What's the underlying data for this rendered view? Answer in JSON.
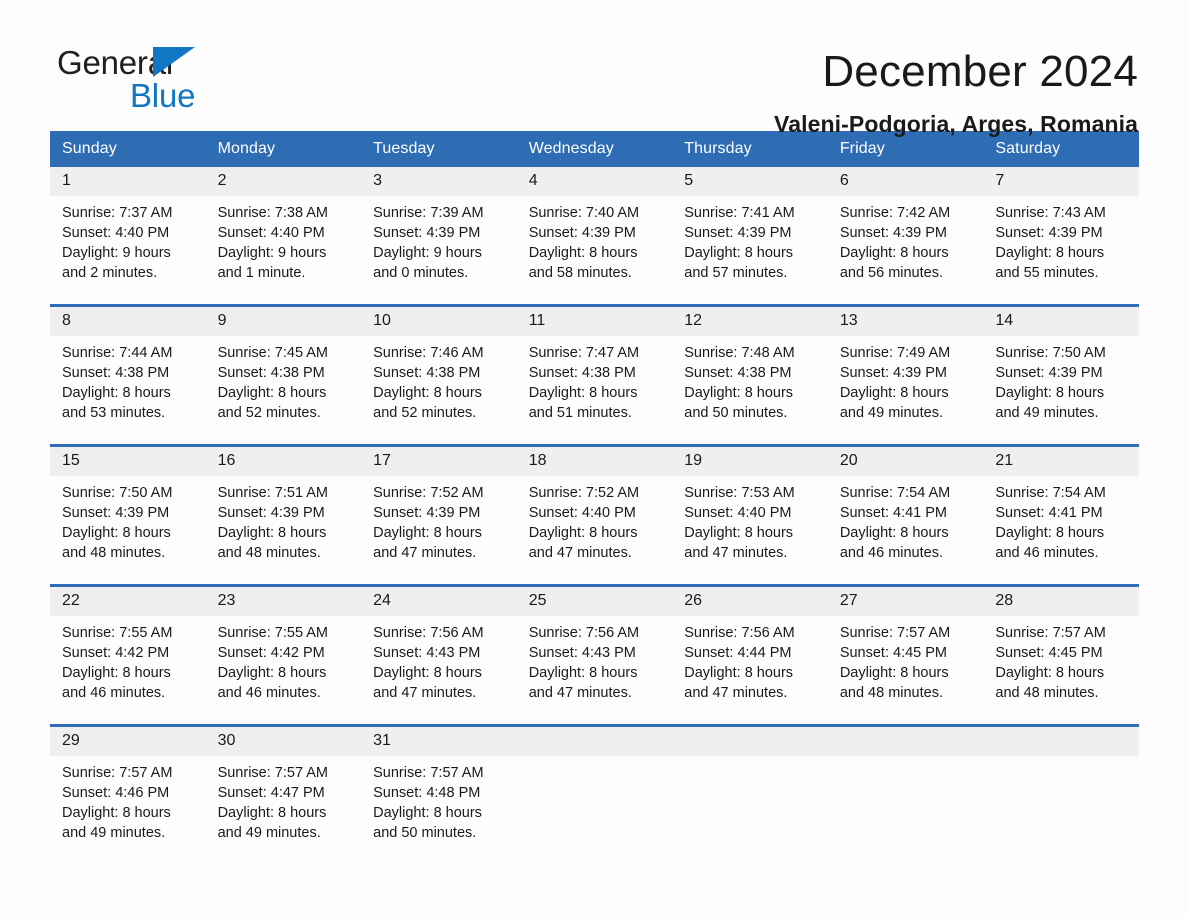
{
  "brand": {
    "name_part1": "General",
    "name_part2": "Blue",
    "triangle_color": "#1176c4",
    "icon": "triangle-logo"
  },
  "header": {
    "title": "December 2024",
    "subtitle": "Valeni-Podgoria, Arges, Romania"
  },
  "theme": {
    "header_blue": "#2e6db4",
    "daynum_gray": "#efefef",
    "text": "#1a1a1a",
    "page_bg": "#fdfdfd"
  },
  "weekdays": [
    "Sunday",
    "Monday",
    "Tuesday",
    "Wednesday",
    "Thursday",
    "Friday",
    "Saturday"
  ],
  "weeks": [
    [
      {
        "day": "1",
        "sunrise": "Sunrise: 7:37 AM",
        "sunset": "Sunset: 4:40 PM",
        "daylight1": "Daylight: 9 hours",
        "daylight2": "and 2 minutes."
      },
      {
        "day": "2",
        "sunrise": "Sunrise: 7:38 AM",
        "sunset": "Sunset: 4:40 PM",
        "daylight1": "Daylight: 9 hours",
        "daylight2": "and 1 minute."
      },
      {
        "day": "3",
        "sunrise": "Sunrise: 7:39 AM",
        "sunset": "Sunset: 4:39 PM",
        "daylight1": "Daylight: 9 hours",
        "daylight2": "and 0 minutes."
      },
      {
        "day": "4",
        "sunrise": "Sunrise: 7:40 AM",
        "sunset": "Sunset: 4:39 PM",
        "daylight1": "Daylight: 8 hours",
        "daylight2": "and 58 minutes."
      },
      {
        "day": "5",
        "sunrise": "Sunrise: 7:41 AM",
        "sunset": "Sunset: 4:39 PM",
        "daylight1": "Daylight: 8 hours",
        "daylight2": "and 57 minutes."
      },
      {
        "day": "6",
        "sunrise": "Sunrise: 7:42 AM",
        "sunset": "Sunset: 4:39 PM",
        "daylight1": "Daylight: 8 hours",
        "daylight2": "and 56 minutes."
      },
      {
        "day": "7",
        "sunrise": "Sunrise: 7:43 AM",
        "sunset": "Sunset: 4:39 PM",
        "daylight1": "Daylight: 8 hours",
        "daylight2": "and 55 minutes."
      }
    ],
    [
      {
        "day": "8",
        "sunrise": "Sunrise: 7:44 AM",
        "sunset": "Sunset: 4:38 PM",
        "daylight1": "Daylight: 8 hours",
        "daylight2": "and 53 minutes."
      },
      {
        "day": "9",
        "sunrise": "Sunrise: 7:45 AM",
        "sunset": "Sunset: 4:38 PM",
        "daylight1": "Daylight: 8 hours",
        "daylight2": "and 52 minutes."
      },
      {
        "day": "10",
        "sunrise": "Sunrise: 7:46 AM",
        "sunset": "Sunset: 4:38 PM",
        "daylight1": "Daylight: 8 hours",
        "daylight2": "and 52 minutes."
      },
      {
        "day": "11",
        "sunrise": "Sunrise: 7:47 AM",
        "sunset": "Sunset: 4:38 PM",
        "daylight1": "Daylight: 8 hours",
        "daylight2": "and 51 minutes."
      },
      {
        "day": "12",
        "sunrise": "Sunrise: 7:48 AM",
        "sunset": "Sunset: 4:38 PM",
        "daylight1": "Daylight: 8 hours",
        "daylight2": "and 50 minutes."
      },
      {
        "day": "13",
        "sunrise": "Sunrise: 7:49 AM",
        "sunset": "Sunset: 4:39 PM",
        "daylight1": "Daylight: 8 hours",
        "daylight2": "and 49 minutes."
      },
      {
        "day": "14",
        "sunrise": "Sunrise: 7:50 AM",
        "sunset": "Sunset: 4:39 PM",
        "daylight1": "Daylight: 8 hours",
        "daylight2": "and 49 minutes."
      }
    ],
    [
      {
        "day": "15",
        "sunrise": "Sunrise: 7:50 AM",
        "sunset": "Sunset: 4:39 PM",
        "daylight1": "Daylight: 8 hours",
        "daylight2": "and 48 minutes."
      },
      {
        "day": "16",
        "sunrise": "Sunrise: 7:51 AM",
        "sunset": "Sunset: 4:39 PM",
        "daylight1": "Daylight: 8 hours",
        "daylight2": "and 48 minutes."
      },
      {
        "day": "17",
        "sunrise": "Sunrise: 7:52 AM",
        "sunset": "Sunset: 4:39 PM",
        "daylight1": "Daylight: 8 hours",
        "daylight2": "and 47 minutes."
      },
      {
        "day": "18",
        "sunrise": "Sunrise: 7:52 AM",
        "sunset": "Sunset: 4:40 PM",
        "daylight1": "Daylight: 8 hours",
        "daylight2": "and 47 minutes."
      },
      {
        "day": "19",
        "sunrise": "Sunrise: 7:53 AM",
        "sunset": "Sunset: 4:40 PM",
        "daylight1": "Daylight: 8 hours",
        "daylight2": "and 47 minutes."
      },
      {
        "day": "20",
        "sunrise": "Sunrise: 7:54 AM",
        "sunset": "Sunset: 4:41 PM",
        "daylight1": "Daylight: 8 hours",
        "daylight2": "and 46 minutes."
      },
      {
        "day": "21",
        "sunrise": "Sunrise: 7:54 AM",
        "sunset": "Sunset: 4:41 PM",
        "daylight1": "Daylight: 8 hours",
        "daylight2": "and 46 minutes."
      }
    ],
    [
      {
        "day": "22",
        "sunrise": "Sunrise: 7:55 AM",
        "sunset": "Sunset: 4:42 PM",
        "daylight1": "Daylight: 8 hours",
        "daylight2": "and 46 minutes."
      },
      {
        "day": "23",
        "sunrise": "Sunrise: 7:55 AM",
        "sunset": "Sunset: 4:42 PM",
        "daylight1": "Daylight: 8 hours",
        "daylight2": "and 46 minutes."
      },
      {
        "day": "24",
        "sunrise": "Sunrise: 7:56 AM",
        "sunset": "Sunset: 4:43 PM",
        "daylight1": "Daylight: 8 hours",
        "daylight2": "and 47 minutes."
      },
      {
        "day": "25",
        "sunrise": "Sunrise: 7:56 AM",
        "sunset": "Sunset: 4:43 PM",
        "daylight1": "Daylight: 8 hours",
        "daylight2": "and 47 minutes."
      },
      {
        "day": "26",
        "sunrise": "Sunrise: 7:56 AM",
        "sunset": "Sunset: 4:44 PM",
        "daylight1": "Daylight: 8 hours",
        "daylight2": "and 47 minutes."
      },
      {
        "day": "27",
        "sunrise": "Sunrise: 7:57 AM",
        "sunset": "Sunset: 4:45 PM",
        "daylight1": "Daylight: 8 hours",
        "daylight2": "and 48 minutes."
      },
      {
        "day": "28",
        "sunrise": "Sunrise: 7:57 AM",
        "sunset": "Sunset: 4:45 PM",
        "daylight1": "Daylight: 8 hours",
        "daylight2": "and 48 minutes."
      }
    ],
    [
      {
        "day": "29",
        "sunrise": "Sunrise: 7:57 AM",
        "sunset": "Sunset: 4:46 PM",
        "daylight1": "Daylight: 8 hours",
        "daylight2": "and 49 minutes."
      },
      {
        "day": "30",
        "sunrise": "Sunrise: 7:57 AM",
        "sunset": "Sunset: 4:47 PM",
        "daylight1": "Daylight: 8 hours",
        "daylight2": "and 49 minutes."
      },
      {
        "day": "31",
        "sunrise": "Sunrise: 7:57 AM",
        "sunset": "Sunset: 4:48 PM",
        "daylight1": "Daylight: 8 hours",
        "daylight2": "and 50 minutes."
      },
      {
        "day": "",
        "sunrise": "",
        "sunset": "",
        "daylight1": "",
        "daylight2": ""
      },
      {
        "day": "",
        "sunrise": "",
        "sunset": "",
        "daylight1": "",
        "daylight2": ""
      },
      {
        "day": "",
        "sunrise": "",
        "sunset": "",
        "daylight1": "",
        "daylight2": ""
      },
      {
        "day": "",
        "sunrise": "",
        "sunset": "",
        "daylight1": "",
        "daylight2": ""
      }
    ]
  ]
}
